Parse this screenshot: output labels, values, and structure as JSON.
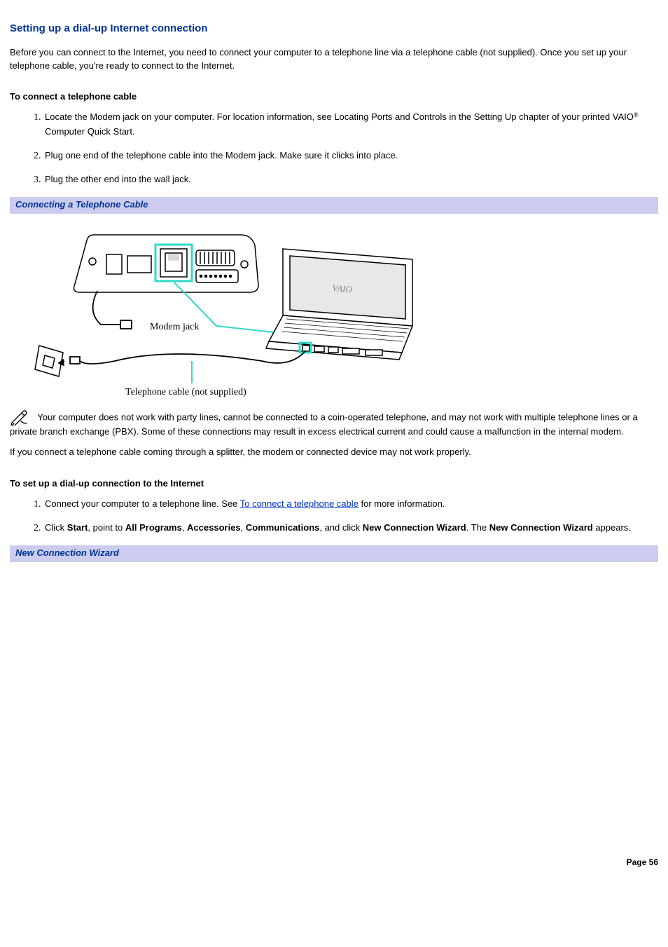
{
  "section": {
    "title": "Setting up a dial-up Internet connection",
    "intro": "Before you can connect to the Internet, you need to connect your computer to a telephone line via a telephone cable (not supplied). Once you set up your telephone cable, you're ready to connect to the Internet."
  },
  "connect_cable": {
    "heading": "To connect a telephone cable",
    "step1_a": "Locate the Modem jack on your computer. For location information, see Locating Ports and Controls in the Setting Up chapter of your printed VAIO",
    "step1_reg": "®",
    "step1_b": " Computer Quick Start.",
    "step2": "Plug one end of the telephone cable into the Modem jack. Make sure it clicks into place.",
    "step3": "Plug the other end into the wall jack."
  },
  "figure1": {
    "caption": "Connecting a Telephone Cable",
    "label_modem": "Modem jack",
    "label_cable": "Telephone cable (not supplied)",
    "label_vaio": "VAIO"
  },
  "note": {
    "text": "Your computer does not work with party lines, cannot be connected to a coin-operated telephone, and may not work with multiple telephone lines or a private branch exchange (PBX). Some of these connections may result in excess electrical current and could cause a malfunction in the internal modem.",
    "splitter": "If you connect a telephone cable coming through a splitter, the modem or connected device may not work properly."
  },
  "setup_dialup": {
    "heading": "To set up a dial-up connection to the Internet",
    "step1_a": "Connect your computer to a telephone line. See ",
    "step1_link": "To connect a telephone cable",
    "step1_b": " for more information.",
    "step2": {
      "t1": "Click ",
      "b1": "Start",
      "t2": ", point to ",
      "b2": "All Programs",
      "t3": ", ",
      "b3": "Accessories",
      "t4": ", ",
      "b4": "Communications",
      "t5": ", and click ",
      "b5": "New Connection Wizard",
      "t6": ". The ",
      "b6": "New Connection Wizard",
      "t7": " appears."
    }
  },
  "figure2": {
    "caption": "New Connection Wizard"
  },
  "footer": {
    "page": "Page 56"
  }
}
